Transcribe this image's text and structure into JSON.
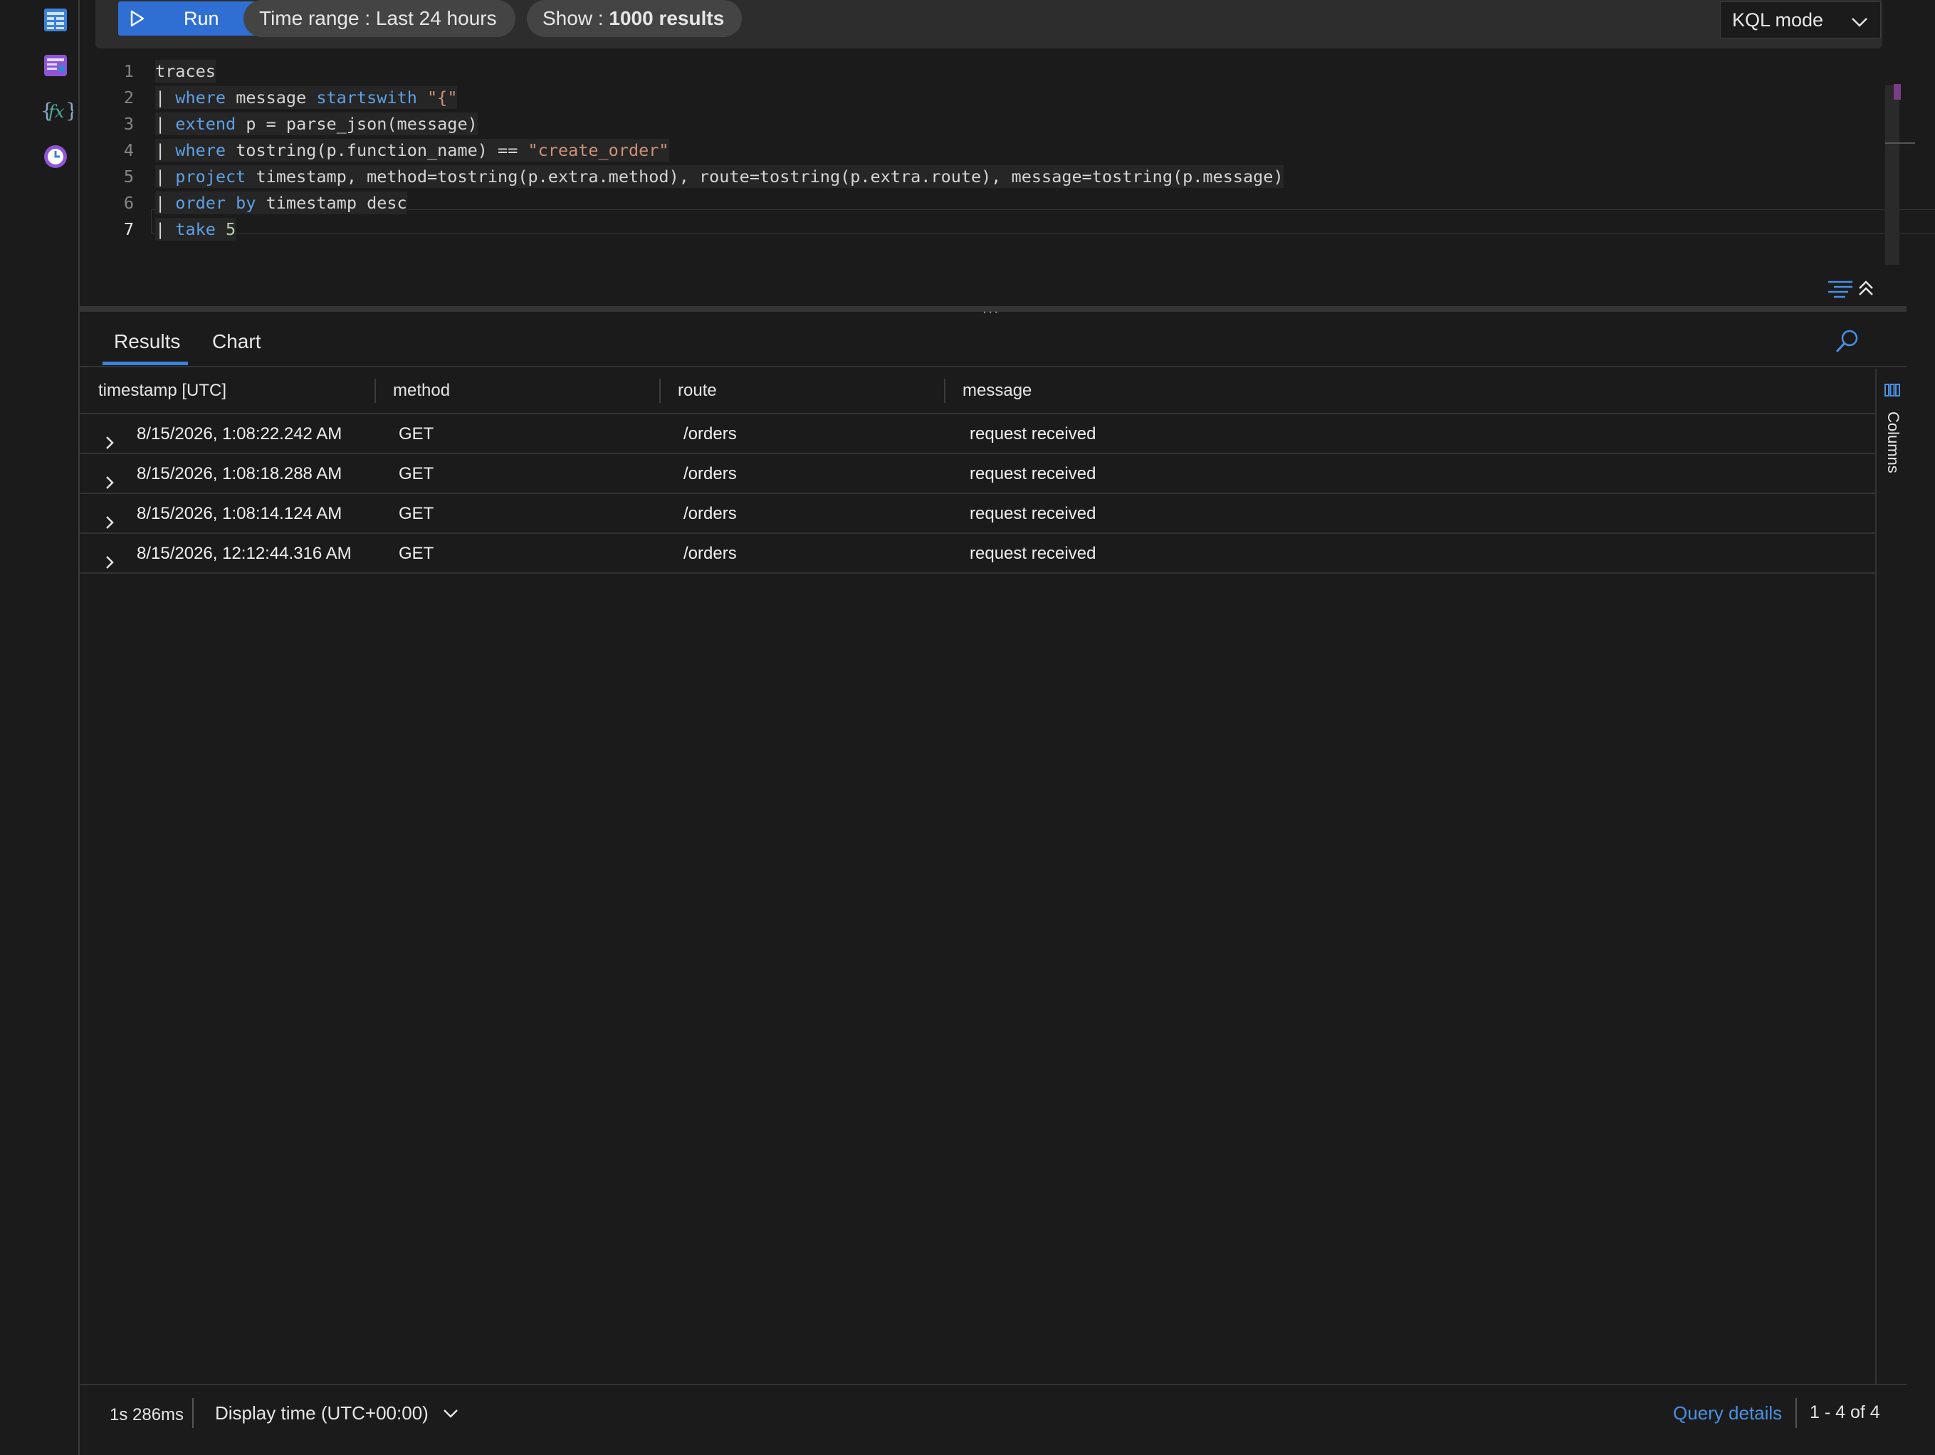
{
  "toolbar": {
    "run_label": "Run",
    "time_range_label": "Time range :",
    "time_range_value": "Last 24 hours",
    "show_label": "Show :",
    "show_value": "1000 results",
    "mode_label": "KQL mode"
  },
  "editor": {
    "line_numbers": [
      "1",
      "2",
      "3",
      "4",
      "5",
      "6",
      "7"
    ],
    "lines": [
      [
        {
          "t": "traces",
          "c": ""
        }
      ],
      [
        {
          "t": "| ",
          "c": ""
        },
        {
          "t": "where",
          "c": "kw"
        },
        {
          "t": " message ",
          "c": ""
        },
        {
          "t": "startswith",
          "c": "kw"
        },
        {
          "t": " ",
          "c": ""
        },
        {
          "t": "\"{\"",
          "c": "str"
        }
      ],
      [
        {
          "t": "| ",
          "c": ""
        },
        {
          "t": "extend",
          "c": "kw"
        },
        {
          "t": " p = parse_json(message)",
          "c": ""
        }
      ],
      [
        {
          "t": "| ",
          "c": ""
        },
        {
          "t": "where",
          "c": "kw"
        },
        {
          "t": " tostring(p.function_name) == ",
          "c": ""
        },
        {
          "t": "\"create_order\"",
          "c": "str"
        }
      ],
      [
        {
          "t": "| ",
          "c": ""
        },
        {
          "t": "project",
          "c": "kw"
        },
        {
          "t": " timestamp, method=tostring(p.extra.method), route=tostring(p.extra.route), message=tostring(p.message)",
          "c": ""
        }
      ],
      [
        {
          "t": "| ",
          "c": ""
        },
        {
          "t": "order by",
          "c": "kw"
        },
        {
          "t": " timestamp desc",
          "c": ""
        }
      ],
      [
        {
          "t": "| ",
          "c": ""
        },
        {
          "t": "take",
          "c": "kw"
        },
        {
          "t": " ",
          "c": ""
        },
        {
          "t": "5",
          "c": "num"
        }
      ]
    ],
    "active_line": 7
  },
  "tabs": [
    {
      "label": "Results",
      "active": true
    },
    {
      "label": "Chart",
      "active": false
    }
  ],
  "results": {
    "columns": [
      "timestamp [UTC]",
      "method",
      "route",
      "message"
    ],
    "rows": [
      [
        "8/15/2026, 1:08:22.242 AM",
        "GET",
        "/orders",
        "request received"
      ],
      [
        "8/15/2026, 1:08:18.288 AM",
        "GET",
        "/orders",
        "request received"
      ],
      [
        "8/15/2026, 1:08:14.124 AM",
        "GET",
        "/orders",
        "request received"
      ],
      [
        "8/15/2026, 12:12:44.316 AM",
        "GET",
        "/orders",
        "request received"
      ]
    ],
    "columns_panel_label": "Columns"
  },
  "footer": {
    "duration": "1s 286ms",
    "display_time": "Display time (UTC+00:00)",
    "query_details": "Query details",
    "count": "1 - 4 of 4"
  },
  "colors": {
    "accent": "#2f6fd4",
    "link": "#4a90e2",
    "keyword": "#5fa0e6",
    "string": "#ce9178",
    "number": "#b5cea8"
  },
  "icons": {
    "rail": [
      "table-icon",
      "workbook-icon",
      "function-icon",
      "query-history-icon"
    ],
    "toolbar": [
      "play-icon",
      "chevron-down-icon"
    ],
    "editor": [
      "format-query-icon",
      "collapse-icon"
    ],
    "results": [
      "search-icon",
      "expand-row-icon",
      "columns-icon"
    ]
  }
}
